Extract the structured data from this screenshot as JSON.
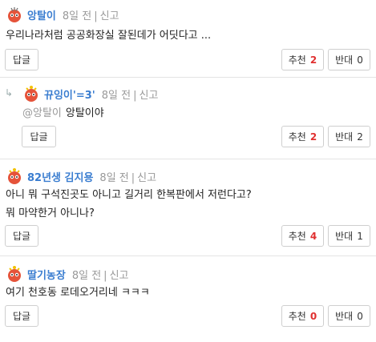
{
  "comments": [
    {
      "nick": "앙탈이",
      "time": "8일 전",
      "report": "신고",
      "lines": [
        "우리나라처럼 공공화장실 잘된데가 어딧다고 ..."
      ],
      "reply": "답글",
      "up_label": "추천",
      "up": "2",
      "down_label": "반대",
      "down": "0"
    },
    {
      "nick": "뀨잉이'=3'",
      "time": "8일 전",
      "report": "신고",
      "mention": "@앙탈이",
      "lines": [
        "앙탈이야"
      ],
      "reply": "답글",
      "up_label": "추천",
      "up": "2",
      "down_label": "반대",
      "down": "2",
      "reply_marker": "↳"
    },
    {
      "nick": "82년생 김지용",
      "time": "8일 전",
      "report": "신고",
      "lines": [
        "아니 뭐 구석진곳도 아니고 길거리 한복판에서 저런다고?",
        "뭐 마약한거 아니나?"
      ],
      "reply": "답글",
      "up_label": "추천",
      "up": "4",
      "down_label": "반대",
      "down": "1"
    },
    {
      "nick": "딸기농장",
      "time": "8일 전",
      "report": "신고",
      "lines": [
        "여기 천호동 로데오거리네 ㅋㅋㅋ"
      ],
      "reply": "답글",
      "up_label": "추천",
      "up": "0",
      "down_label": "반대",
      "down": "0"
    }
  ],
  "colors": {
    "nick": "#3a7dd0",
    "up_count": "#e03030",
    "meta": "#999999"
  },
  "icons": {
    "avatar": "red-mascot-icon",
    "reply": "reply-arrow-icon"
  }
}
